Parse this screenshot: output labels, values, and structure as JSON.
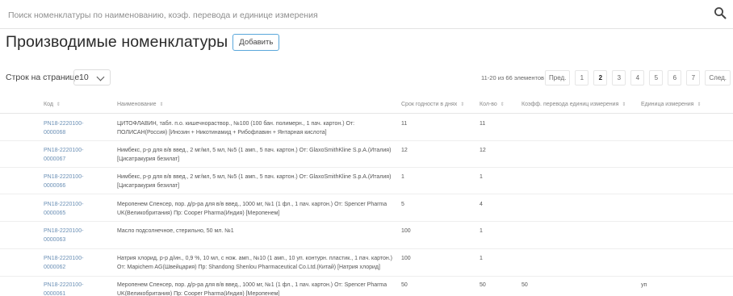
{
  "search": {
    "placeholder": "Поиск номенклатуры по наименованию, коэф. перевода и единице измерения"
  },
  "header": {
    "title": "Производимые номенклатуры",
    "add_label": "Добавить"
  },
  "toolbar": {
    "rows_label": "Строк на странице",
    "rows_value": "10",
    "range_info": "11-20 из 66 элементов",
    "prev_label": "Пред.",
    "next_label": "След.",
    "pages": [
      "1",
      "2",
      "3",
      "4",
      "5",
      "6",
      "7"
    ],
    "current_page": "2"
  },
  "table": {
    "columns": [
      "Код",
      "Наименование",
      "Срок годности в днях",
      "Кол-во",
      "Коэфф. перевода единиц измерения",
      "Единица измерения"
    ],
    "rows": [
      {
        "code": "PN18-2220100-0000068",
        "name": "ЦИТОФЛАВИН, табл. п.о. кишечнораствор., №100 (100 бан. полимерн., 1 пач. картон.) От: ПОЛИСАН(Россия) [Инозин + Никотинамид + Рибофлавин + Янтарная кислота]",
        "term": "11",
        "qty": "11",
        "coef": "",
        "unit": ""
      },
      {
        "code": "PN18-2220100-0000067",
        "name": "Нимбекс, р-р для в/в введ., 2 мг/мл, 5 мл, №5 (1 амп., 5 пач. картон.) От: GlaxoSmithKline S.p.A.(Италия) [Цисатракурия безилат]",
        "term": "12",
        "qty": "12",
        "coef": "",
        "unit": ""
      },
      {
        "code": "PN18-2220100-0000066",
        "name": "Нимбекс, р-р для в/в введ., 2 мг/мл, 5 мл, №5 (1 амп., 5 пач. картон.) От: GlaxoSmithKline S.p.A.(Италия) [Цисатракурия безилат]",
        "term": "1",
        "qty": "1",
        "coef": "",
        "unit": ""
      },
      {
        "code": "PN18-2220100-0000065",
        "name": "Меропенем Спенсер, пор. д/р-ра для в/в введ., 1000 мг, №1 (1 фл., 1 пач. картон.) От: Spencer Pharma UK(Великобритания) Пр: Cooper Pharma(Индия) [Меропенем]",
        "term": "5",
        "qty": "4",
        "coef": "",
        "unit": ""
      },
      {
        "code": "PN18-2220100-0000063",
        "name": "Масло подсолнечное, стерильно, 50 мл. №1",
        "term": "100",
        "qty": "1",
        "coef": "",
        "unit": ""
      },
      {
        "code": "PN18-2220100-0000062",
        "name": "Натрия хлорид, р-р д/ин., 0,9 %, 10 мл, с нож. амп., №10 (1 амп., 10 уп. контурн. пластик., 1 пач. картон.) От: Mapichem AG(Швейцария) Пр: Shandong Shenlou Pharmaceutical Co.Ltd.(Китай) [Натрия хлорид]",
        "term": "100",
        "qty": "1",
        "coef": "",
        "unit": ""
      },
      {
        "code": "PN18-2220100-0000061",
        "name": "Меропенем Спенсер, пор. д/р-ра для в/в введ., 1000 мг, №1 (1 фл., 1 пач. картон.) От: Spencer Pharma UK(Великобритания) Пр: Cooper Pharma(Индия) [Меропенем]",
        "term": "50",
        "qty": "50",
        "coef": "50",
        "unit": "уп"
      }
    ]
  },
  "icons": {
    "search": "search-icon",
    "sort": "sort-icon",
    "dropdown": "chevron-down-icon"
  },
  "colors": {
    "accent": "#5aa7db",
    "code_text": "#6a8fb5"
  }
}
